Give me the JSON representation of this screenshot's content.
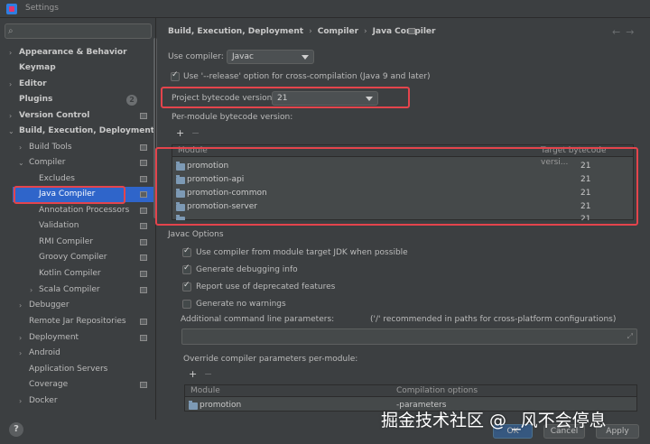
{
  "window": {
    "title": "Settings"
  },
  "search": {
    "placeholder": ""
  },
  "sidebar": {
    "items": [
      {
        "label": "Appearance & Behavior"
      },
      {
        "label": "Keymap"
      },
      {
        "label": "Editor"
      },
      {
        "label": "Plugins",
        "badge": "2"
      },
      {
        "label": "Version Control"
      },
      {
        "label": "Build, Execution, Deployment"
      },
      {
        "label": "Build Tools"
      },
      {
        "label": "Compiler"
      },
      {
        "label": "Excludes"
      },
      {
        "label": "Java Compiler"
      },
      {
        "label": "Annotation Processors"
      },
      {
        "label": "Validation"
      },
      {
        "label": "RMI Compiler"
      },
      {
        "label": "Groovy Compiler"
      },
      {
        "label": "Kotlin Compiler"
      },
      {
        "label": "Scala Compiler"
      },
      {
        "label": "Debugger"
      },
      {
        "label": "Remote Jar Repositories"
      },
      {
        "label": "Deployment"
      },
      {
        "label": "Android"
      },
      {
        "label": "Application Servers"
      },
      {
        "label": "Coverage"
      },
      {
        "label": "Docker"
      }
    ]
  },
  "breadcrumb": [
    "Build, Execution, Deployment",
    "Compiler",
    "Java Compiler"
  ],
  "main": {
    "use_compiler_label": "Use compiler:",
    "use_compiler_value": "Javac",
    "release_option_label": "Use '--release' option for cross-compilation (Java 9 and later)",
    "bytecode_label": "Project bytecode version:",
    "bytecode_value": "21",
    "per_module_label": "Per-module bytecode version:",
    "module_table": {
      "columns": [
        "Module",
        "Target bytecode versi..."
      ],
      "rows": [
        {
          "module": "promotion",
          "version": "21"
        },
        {
          "module": "promotion-api",
          "version": "21"
        },
        {
          "module": "promotion-common",
          "version": "21"
        },
        {
          "module": "promotion-server",
          "version": "21"
        },
        {
          "module": "",
          "version": "21"
        }
      ]
    },
    "javac_options_title": "Javac Options",
    "options": [
      {
        "label": "Use compiler from module target JDK when possible",
        "checked": true
      },
      {
        "label": "Generate debugging info",
        "checked": true
      },
      {
        "label": "Report use of deprecated features",
        "checked": true
      },
      {
        "label": "Generate no warnings",
        "checked": false
      }
    ],
    "additional_params_label": "Additional command line parameters:",
    "additional_params_hint": "('/' recommended in paths for cross-platform configurations)",
    "override_label": "Override compiler parameters per-module:",
    "override_table": {
      "columns": [
        "Module",
        "Compilation options"
      ],
      "rows": [
        {
          "module": "promotion",
          "options": "-parameters"
        }
      ]
    }
  },
  "buttons": {
    "ok": "OK",
    "cancel": "Cancel",
    "apply": "Apply"
  },
  "watermark": "掘金技术社区 @ _风不会停息",
  "colors": {
    "selection": "#2f65ca",
    "highlight": "#e4444c",
    "background": "#3c3f41"
  }
}
